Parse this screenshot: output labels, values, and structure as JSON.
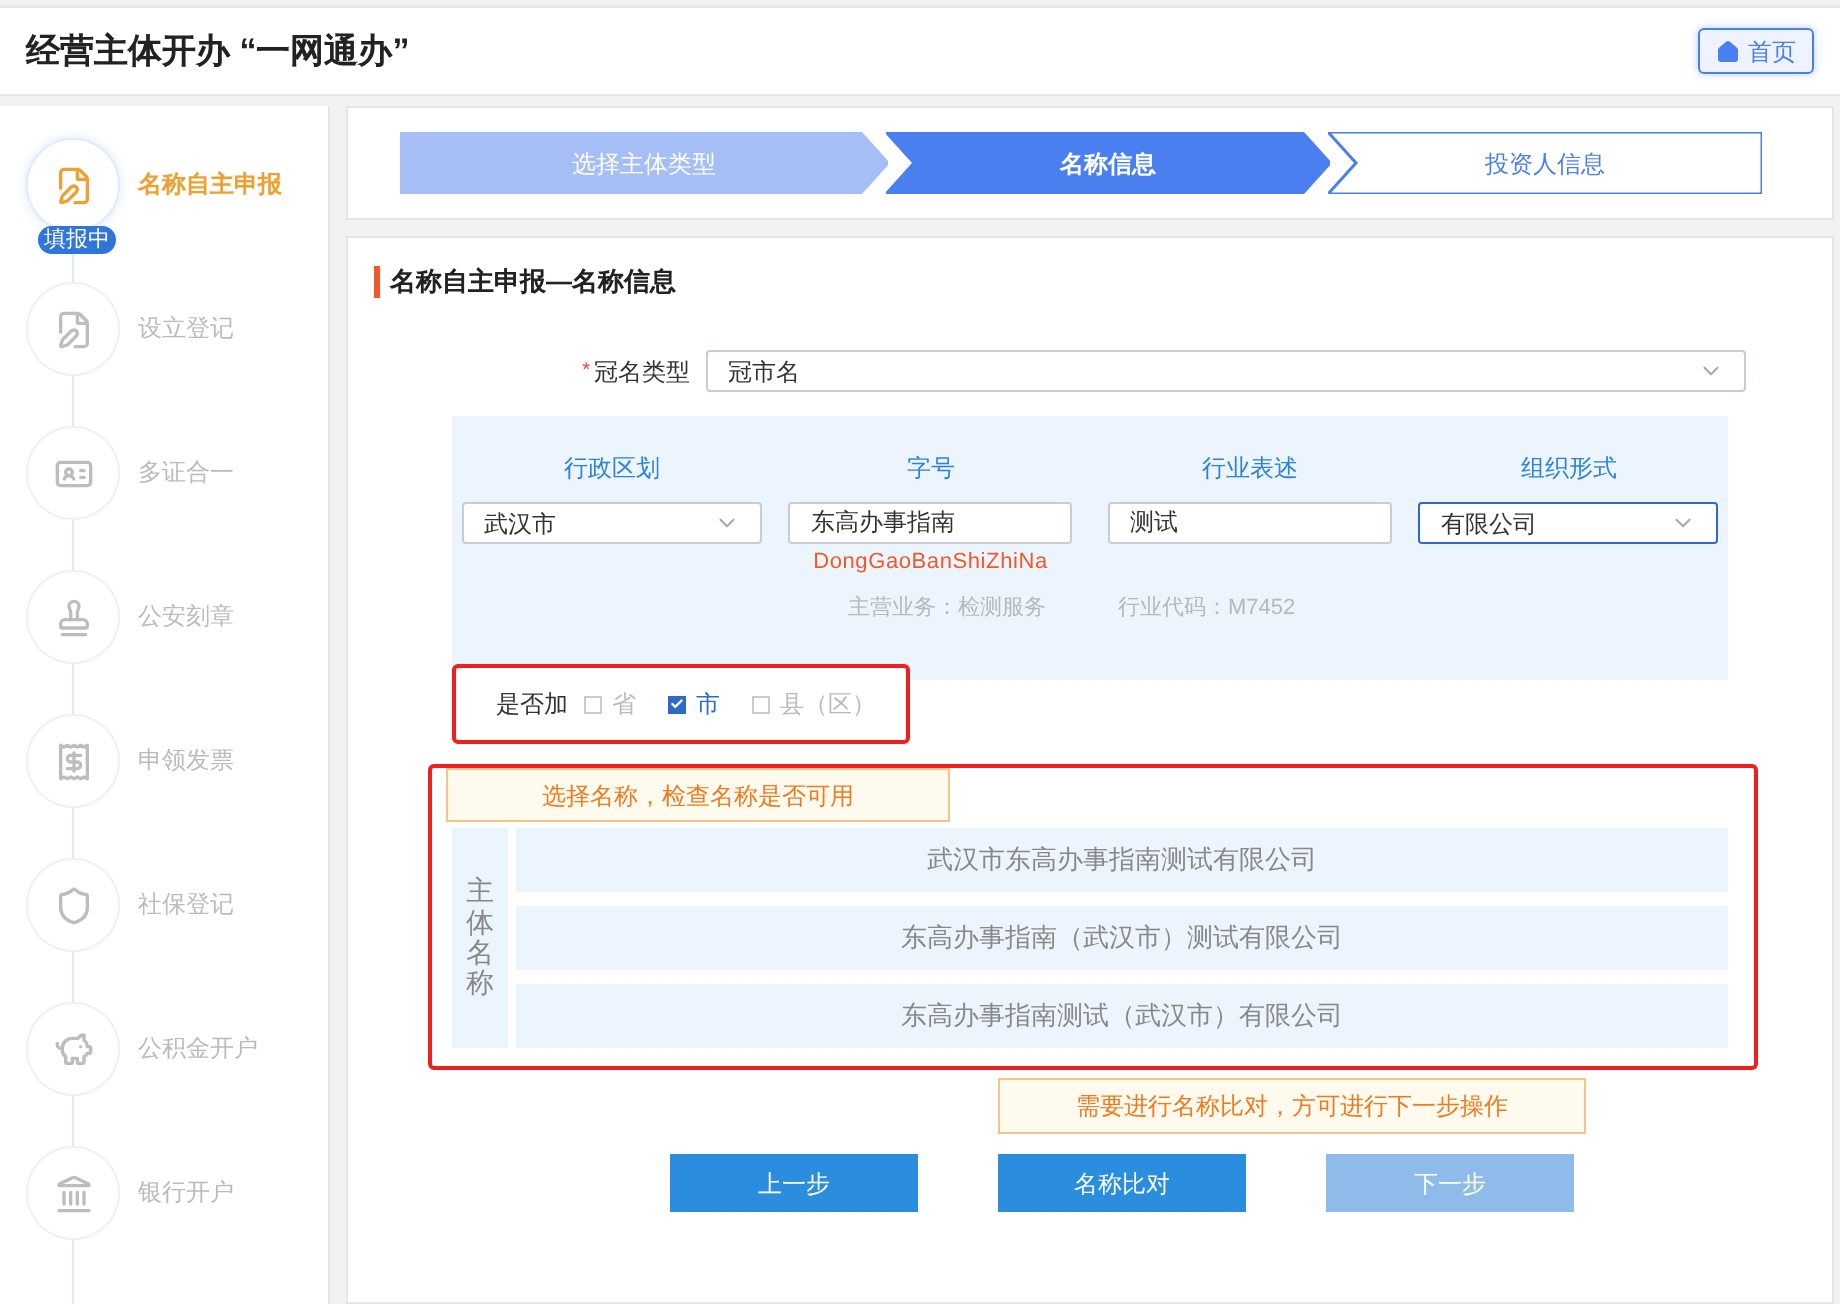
{
  "header": {
    "title": "经营主体开办 “一网通办”",
    "home_button": "首页"
  },
  "sidebar": {
    "items": [
      {
        "label": "名称自主申报",
        "selected": true,
        "badge": "填报中"
      },
      {
        "label": "设立登记",
        "selected": false
      },
      {
        "label": "多证合一",
        "selected": false
      },
      {
        "label": "公安刻章",
        "selected": false
      },
      {
        "label": "申领发票",
        "selected": false
      },
      {
        "label": "社保登记",
        "selected": false
      },
      {
        "label": "公积金开户",
        "selected": false
      },
      {
        "label": "银行开户",
        "selected": false
      }
    ]
  },
  "steps": [
    {
      "label": "选择主体类型",
      "selected": false,
      "completed": true
    },
    {
      "label": "名称信息",
      "selected": true,
      "completed": false
    },
    {
      "label": "投资人信息",
      "selected": false,
      "completed": false
    }
  ],
  "section_title": "名称自主申报—名称信息",
  "name_type": {
    "label": "冠名类型",
    "required_mark": "*",
    "value": "冠市名"
  },
  "name_parts": [
    {
      "label": "行政区划",
      "kind": "select",
      "value": "武汉市",
      "active": false
    },
    {
      "label": "字号",
      "kind": "input",
      "value": "东高办事指南",
      "hint": "DongGaoBanShiZhiNa"
    },
    {
      "label": "行业表述",
      "kind": "input",
      "value": "测试"
    },
    {
      "label": "组织形式",
      "kind": "select",
      "value": "有限公司",
      "active": true
    }
  ],
  "business_info": [
    "主营业务：检测服务",
    "行业代码：M7452"
  ],
  "add_region": {
    "label": "是否加",
    "highlighted": true,
    "options": [
      {
        "label": "省",
        "checked": false
      },
      {
        "label": "市",
        "checked": true
      },
      {
        "label": "县（区）",
        "checked": false
      }
    ]
  },
  "name_choices": {
    "highlighted": true,
    "tip": "选择名称，检查名称是否可用",
    "side_label": "主体名称",
    "names": [
      "武汉市东高办事指南测试有限公司",
      "东高办事指南（武汉市）测试有限公司",
      "东高办事指南测试（武汉市）有限公司"
    ]
  },
  "actions": {
    "tip": "需要进行名称比对，方可进行下一步操作",
    "buttons": [
      {
        "label": "上一步",
        "disabled": false
      },
      {
        "label": "名称比对",
        "disabled": false
      },
      {
        "label": "下一步",
        "disabled": true
      }
    ]
  }
}
